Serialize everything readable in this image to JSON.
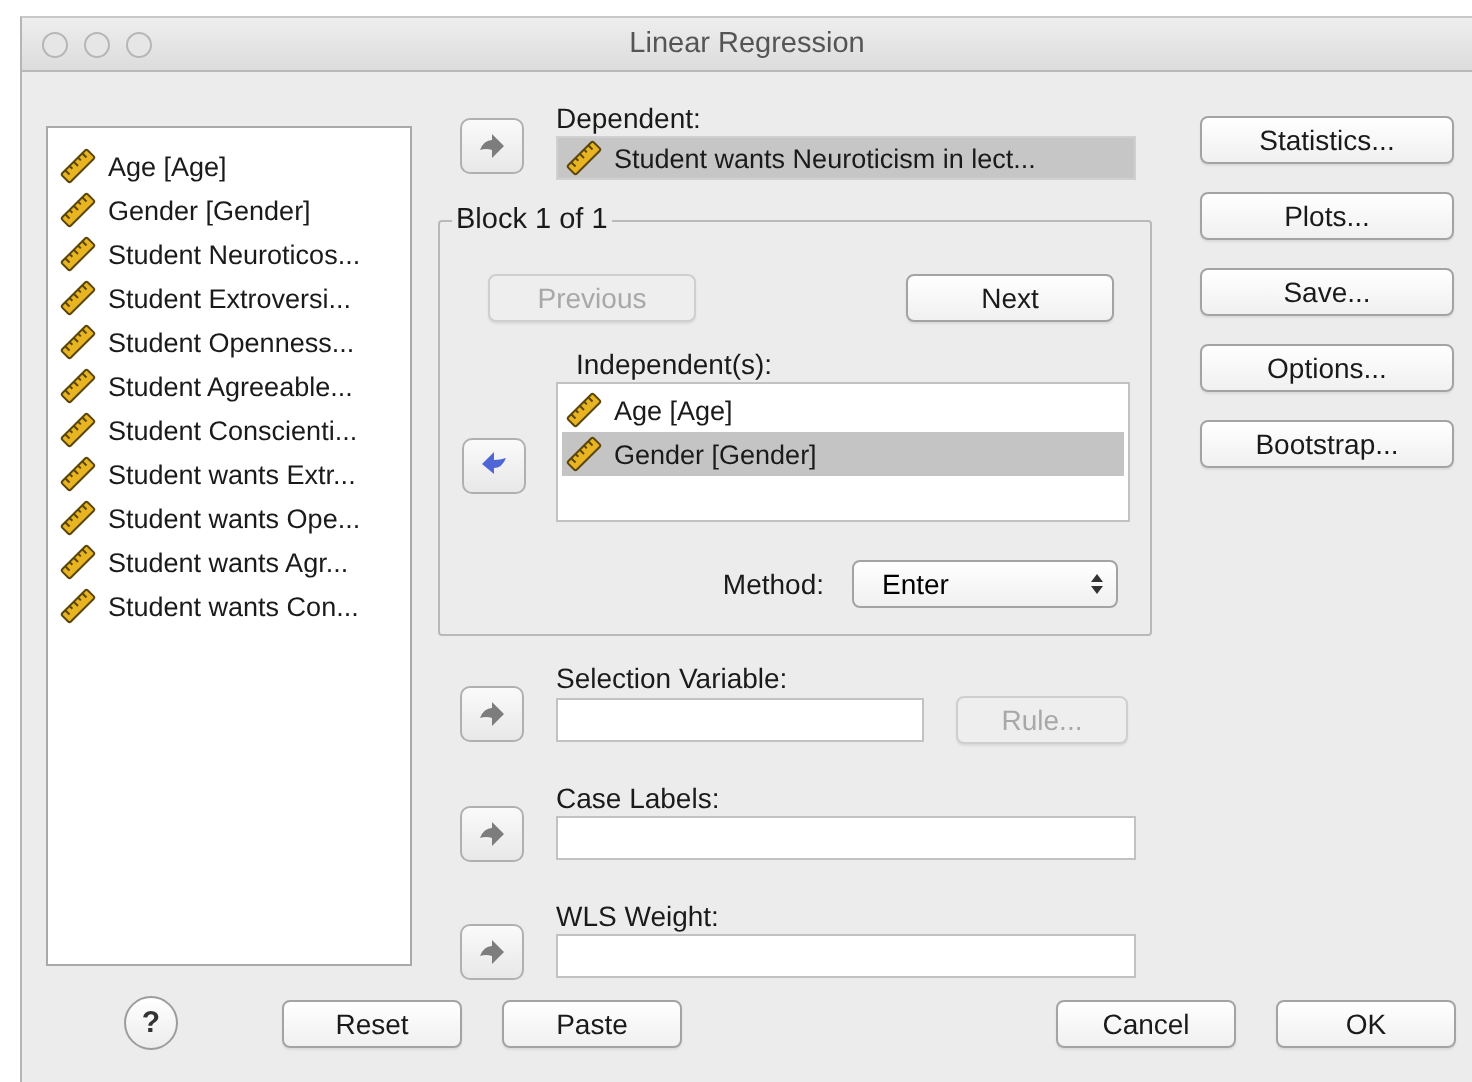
{
  "window": {
    "title": "Linear Regression"
  },
  "variables": [
    {
      "label": "Age [Age]"
    },
    {
      "label": "Gender [Gender]"
    },
    {
      "label": "Student Neuroticos..."
    },
    {
      "label": "Student Extroversi..."
    },
    {
      "label": "Student Openness..."
    },
    {
      "label": "Student Agreeable..."
    },
    {
      "label": "Student Conscienti..."
    },
    {
      "label": "Student wants Extr..."
    },
    {
      "label": "Student wants Ope..."
    },
    {
      "label": "Student wants Agr..."
    },
    {
      "label": "Student wants Con..."
    }
  ],
  "dependent": {
    "label": "Dependent:",
    "arrow": {
      "kind": "right",
      "active": false
    },
    "value": {
      "label": "Student wants Neuroticism in lect...",
      "selected": true
    }
  },
  "block": {
    "title": "Block 1 of 1",
    "previous": {
      "label": "Previous",
      "disabled": true
    },
    "next": {
      "label": "Next",
      "disabled": false
    },
    "independents": {
      "label": "Independent(s):",
      "arrow": {
        "kind": "left",
        "active": true
      },
      "items": [
        {
          "label": "Age [Age]",
          "selected": false
        },
        {
          "label": "Gender [Gender]",
          "selected": true
        }
      ]
    },
    "method": {
      "label": "Method:",
      "value": "Enter"
    }
  },
  "selection_variable": {
    "label": "Selection Variable:",
    "arrow": {
      "kind": "right",
      "active": false
    },
    "rule": {
      "label": "Rule...",
      "disabled": true
    }
  },
  "case_labels": {
    "label": "Case Labels:",
    "arrow": {
      "kind": "right",
      "active": false
    }
  },
  "wls_weight": {
    "label": "WLS Weight:",
    "arrow": {
      "kind": "right",
      "active": false
    }
  },
  "side_buttons": [
    {
      "label": "Statistics..."
    },
    {
      "label": "Plots..."
    },
    {
      "label": "Save..."
    },
    {
      "label": "Options..."
    },
    {
      "label": "Bootstrap..."
    }
  ],
  "help": {
    "label": "?"
  },
  "footer_left": [
    {
      "label": "Reset"
    },
    {
      "label": "Paste"
    }
  ],
  "footer_right": [
    {
      "label": "Cancel"
    },
    {
      "label": "OK"
    }
  ]
}
